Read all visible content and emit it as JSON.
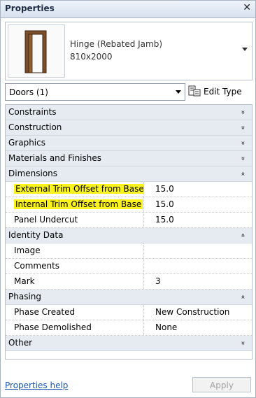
{
  "panel": {
    "title": "Properties",
    "close_glyph": "✕"
  },
  "type_selector": {
    "family": "Hinge (Rebated Jamb)",
    "size": "810x2000",
    "thumbnail_icon": "door-thumbnail-icon"
  },
  "instance_selector": {
    "value": "Doors (1)",
    "edit_type_label": "Edit Type",
    "edit_type_icon": "edit-type-icon"
  },
  "groups": [
    {
      "label": "Constraints",
      "expanded": false,
      "chev": "»"
    },
    {
      "label": "Construction",
      "expanded": false,
      "chev": "»"
    },
    {
      "label": "Graphics",
      "expanded": false,
      "chev": "»"
    },
    {
      "label": "Materials and Finishes",
      "expanded": false,
      "chev": "»"
    },
    {
      "label": "Dimensions",
      "expanded": true,
      "chev": "«",
      "rows": [
        {
          "key": "External Trim Offset from Base",
          "value": "15.0",
          "highlight": true
        },
        {
          "key": "Internal Trim Offset from Base",
          "value": "15.0",
          "highlight": true
        },
        {
          "key": "Panel Undercut",
          "value": "15.0"
        }
      ]
    },
    {
      "label": "Identity Data",
      "expanded": true,
      "chev": "«",
      "rows": [
        {
          "key": "Image",
          "value": ""
        },
        {
          "key": "Comments",
          "value": ""
        },
        {
          "key": "Mark",
          "value": "3"
        }
      ]
    },
    {
      "label": "Phasing",
      "expanded": true,
      "chev": "«",
      "rows": [
        {
          "key": "Phase Created",
          "value": "New Construction"
        },
        {
          "key": "Phase Demolished",
          "value": "None"
        }
      ]
    },
    {
      "label": "Other",
      "expanded": false,
      "chev": "»"
    }
  ],
  "footer": {
    "help_link": "Properties help",
    "apply_label": "Apply"
  },
  "colors": {
    "highlight": "#fbf31e",
    "section_bg": "#e6ebf2",
    "link": "#1a56b5"
  }
}
